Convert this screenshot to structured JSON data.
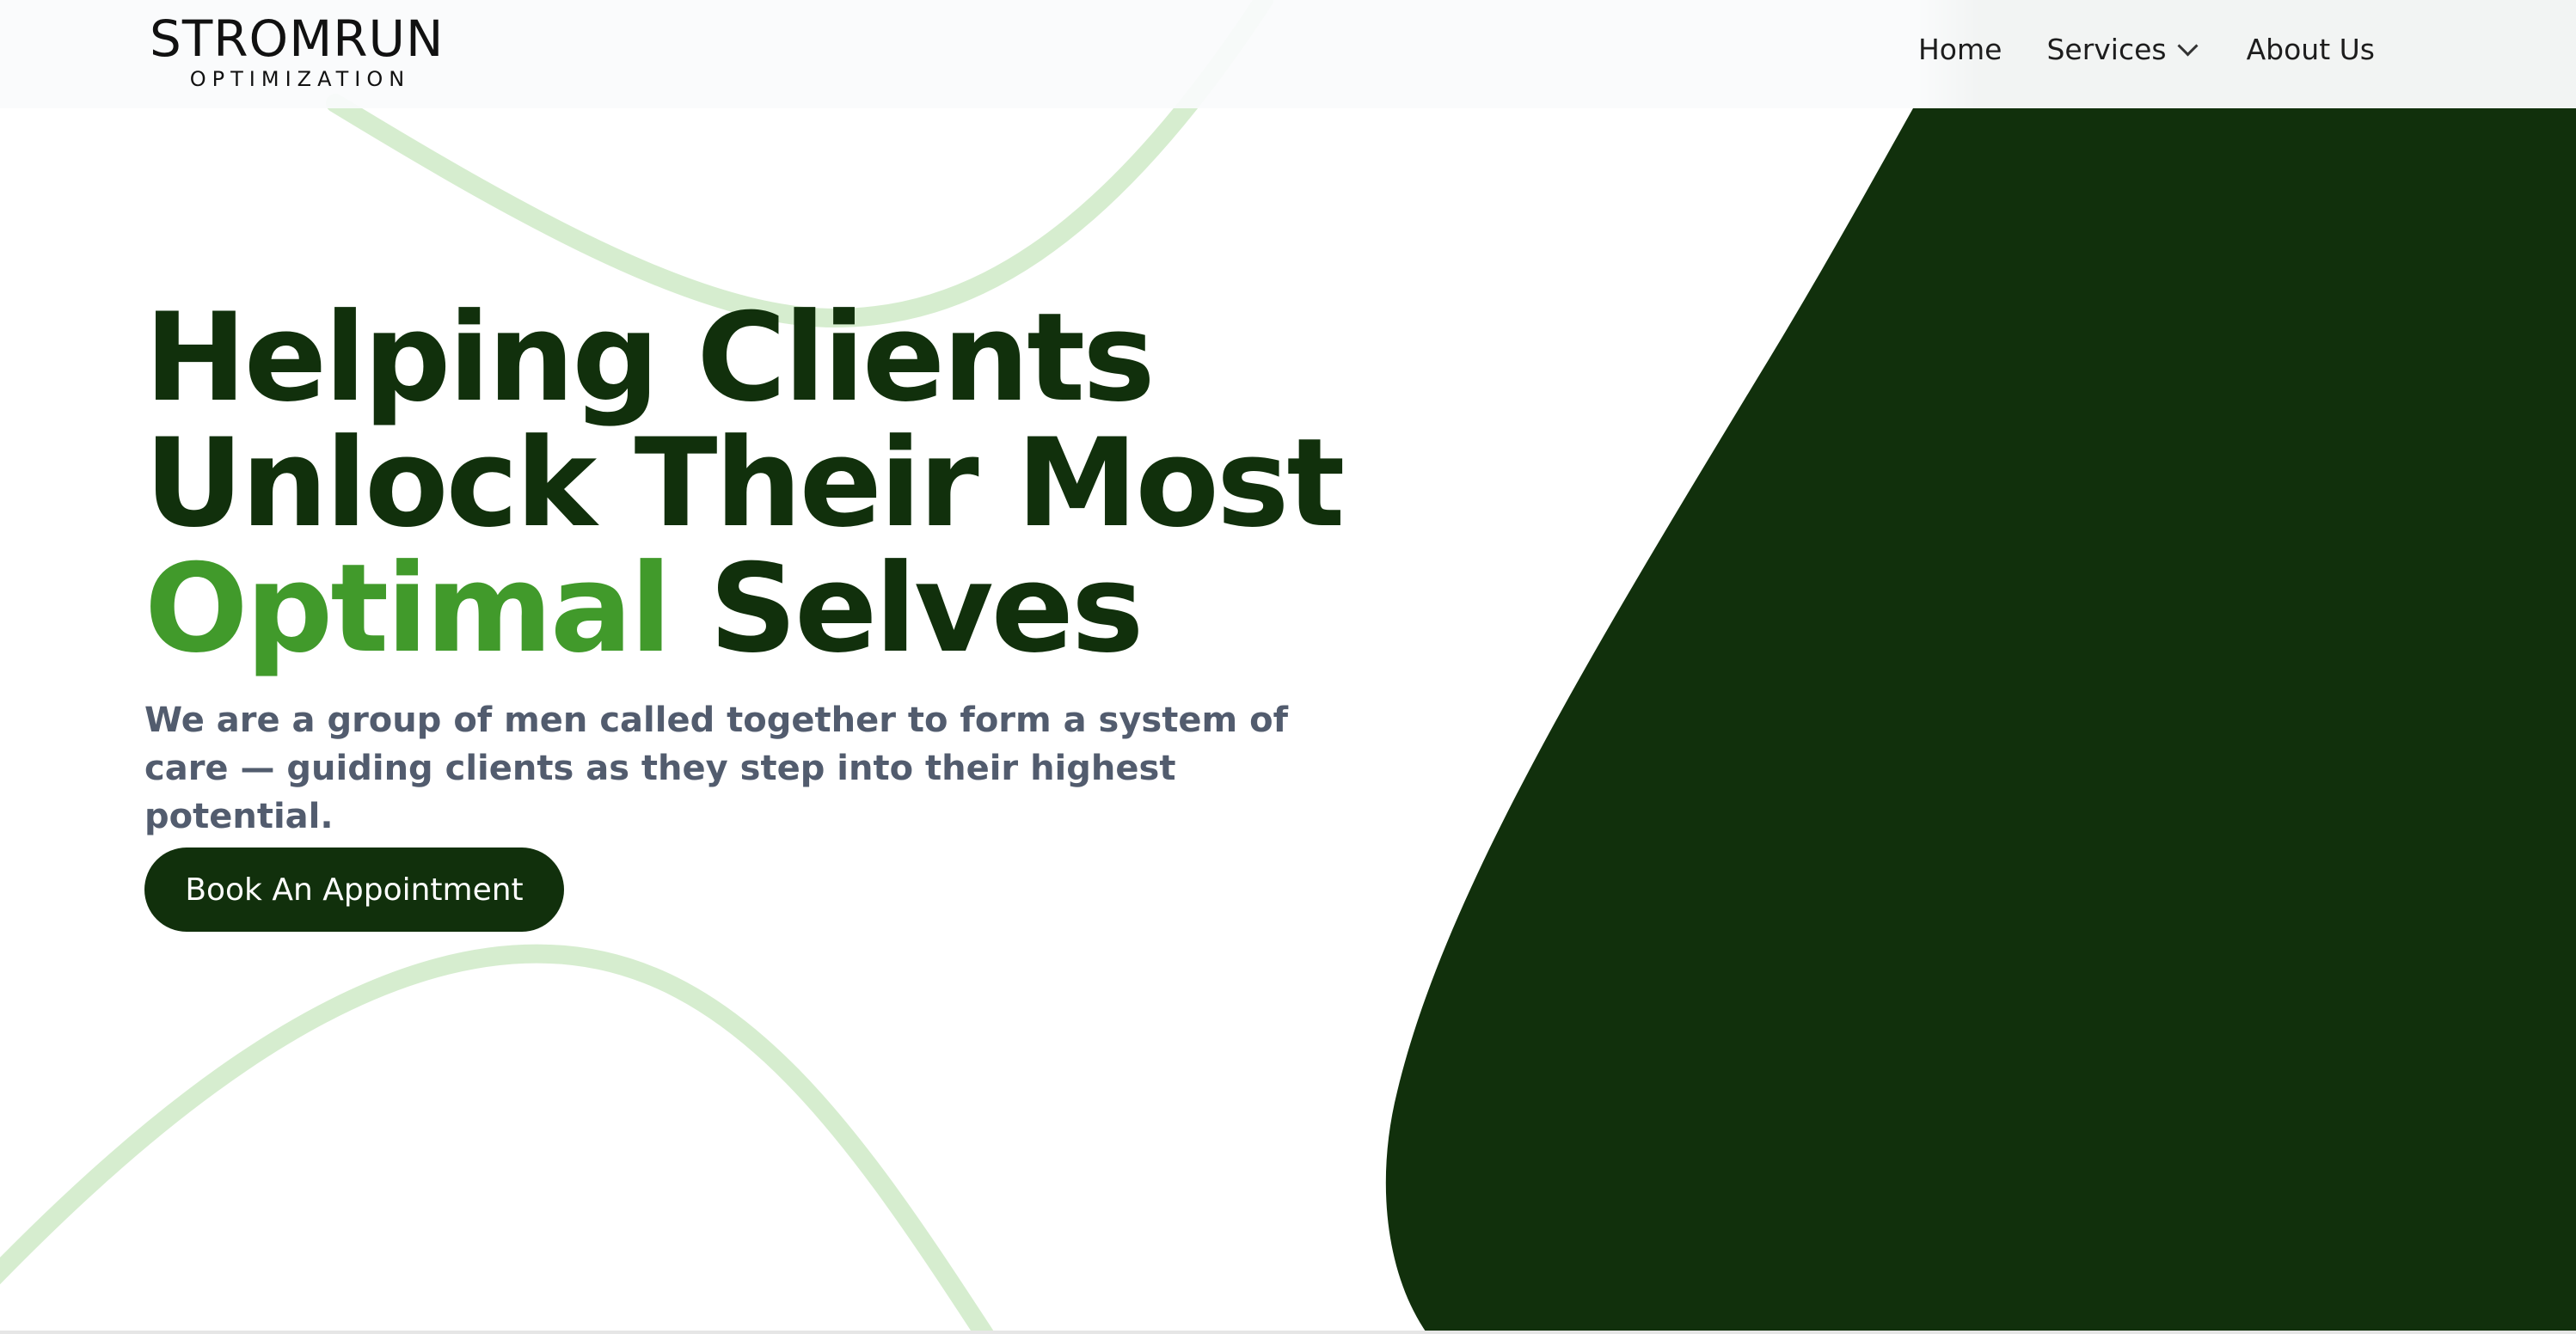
{
  "brand": {
    "name": "STROMRUN",
    "tagline": "OPTIMIZATION"
  },
  "nav": {
    "home": "Home",
    "services": "Services",
    "about": "About Us"
  },
  "hero": {
    "headline_line1": "Helping Clients",
    "headline_line2": "Unlock Their Most",
    "headline_accent": "Optimal",
    "headline_line3_rest": "Selves",
    "subtitle": "We are a group of men called together to form a system of care — guiding clients as they step into their highest potential.",
    "cta": "Book An Appointment"
  },
  "colors": {
    "dark_green": "#11300c",
    "accent_green": "#419a2b",
    "light_green_stroke": "#d6edcf",
    "subtitle_gray": "#525c6e"
  },
  "icons": {
    "services_dropdown": "chevron-down-icon"
  }
}
